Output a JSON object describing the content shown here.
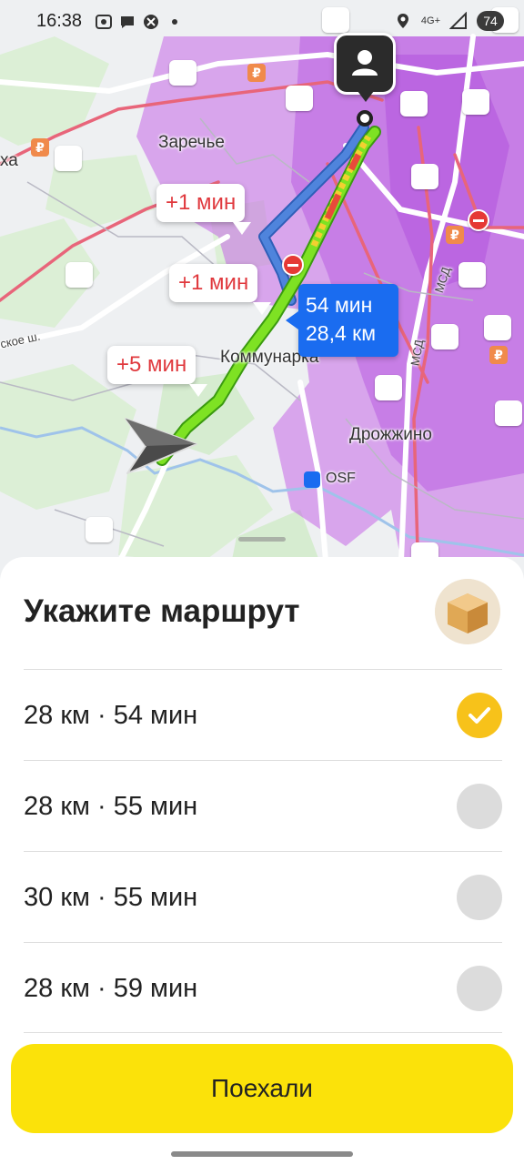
{
  "status_bar": {
    "time": "16:38",
    "network": "4G+",
    "battery": "74",
    "left_icons": [
      "screen-record-icon",
      "chat-icon",
      "dnd-icon",
      "dot-icon"
    ],
    "right_icons": [
      "location-icon",
      "network-icon",
      "signal-icon"
    ]
  },
  "map": {
    "place_labels": {
      "zarechye": "Заречье",
      "kommunarka": "Коммунарка",
      "drozhzhino": "Дрожжино",
      "airport": "OSF",
      "left_edge": "ха",
      "highway": "ское ш.",
      "mcd_1": "МСД",
      "mcd_2": "МСД"
    },
    "route_bubble": {
      "time": "54 мин",
      "distance": "28,4 км"
    },
    "alt_bubbles": [
      "+1 мин",
      "+1 мин",
      "+5 мин"
    ],
    "colors": {
      "route_main": "#76e01b",
      "route_alt": "#4476cf",
      "traffic": "#c667e8",
      "accent_blue": "#1a6cf0"
    }
  },
  "sheet": {
    "title": "Укажите маршрут",
    "routes": [
      {
        "label": "28 км · 54 мин",
        "selected": true
      },
      {
        "label": "28 км · 55 мин",
        "selected": false
      },
      {
        "label": "30 км · 55 мин",
        "selected": false
      },
      {
        "label": "28 км · 59 мин",
        "selected": false
      }
    ],
    "go_button": "Поехали",
    "colors": {
      "go_button": "#fbe20a",
      "selected_radio": "#f7c21a"
    }
  }
}
